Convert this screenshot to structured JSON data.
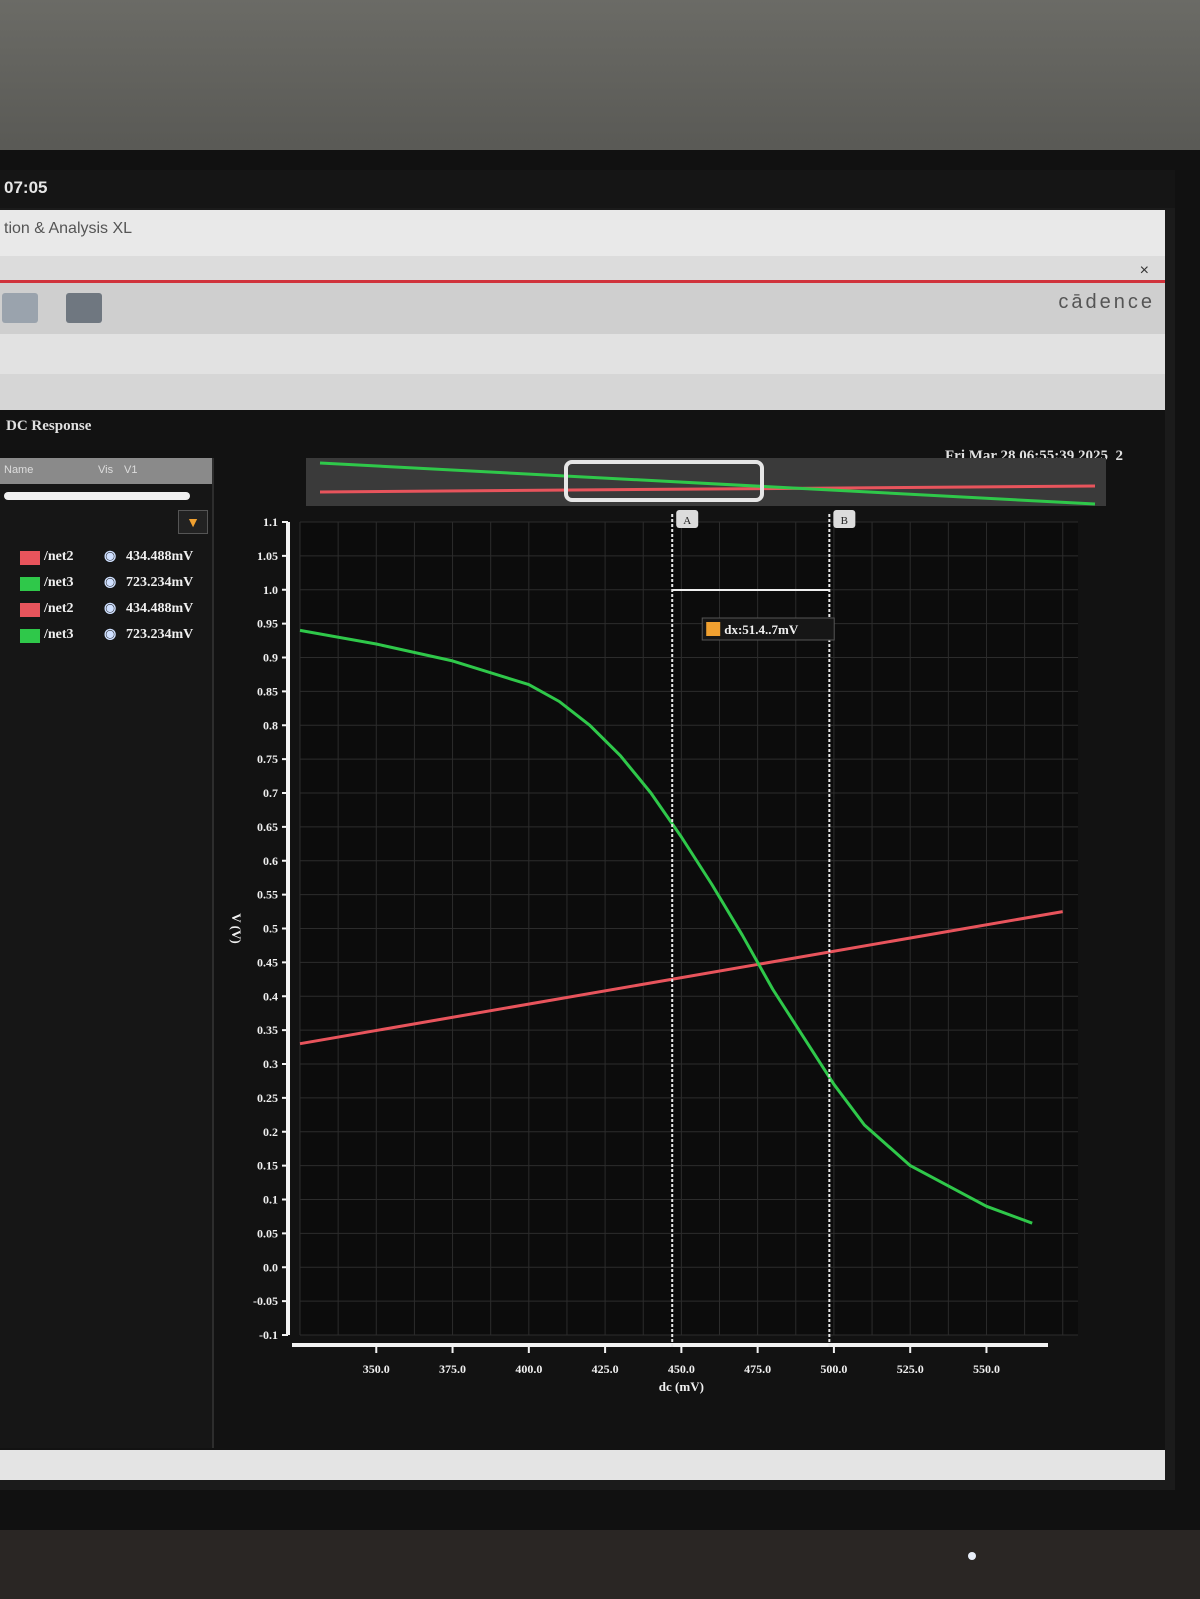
{
  "system": {
    "clock": "07:05",
    "tray_icons": [
      "network-icon",
      "volume-icon",
      "power-icon",
      "chevron-down-icon"
    ]
  },
  "app": {
    "title": "tion & Analysis XL",
    "brand": "cādence",
    "close": "×"
  },
  "window": {
    "title": "DC Response",
    "datetime": "Fri Mar 28 06:55:39 2025",
    "page_num": "2"
  },
  "panel": {
    "columns": [
      "Name",
      "Vis",
      "V1"
    ],
    "signals": [
      {
        "name": "/net2",
        "value": "434.488mV",
        "color": "#e8545c"
      },
      {
        "name": "/net3",
        "value": "723.234mV",
        "color": "#2fc84a"
      },
      {
        "name": "/net2",
        "value": "434.488mV",
        "color": "#e8545c"
      },
      {
        "name": "/net3",
        "value": "723.234mV",
        "color": "#2fc84a"
      }
    ]
  },
  "markers": {
    "a": "A",
    "b": "B",
    "delta": "dx:51.4..7mV",
    "a_x": 447,
    "b_x": 498.5
  },
  "chart_data": {
    "type": "line",
    "xlabel": "dc (mV)",
    "ylabel": "V (V)",
    "xlim": [
      325,
      580
    ],
    "ylim": [
      -0.1,
      1.1
    ],
    "xticks": [
      "350.0",
      "375.0",
      "400.0",
      "425.0",
      "450.0",
      "475.0",
      "500.0",
      "525.0",
      "550.0"
    ],
    "yticks": [
      "1.1",
      "1.05",
      "1.0",
      "0.95",
      "0.9",
      "0.85",
      "0.8",
      "0.75",
      "0.7",
      "0.65",
      "0.6",
      "0.55",
      "0.5",
      "0.45",
      "0.4",
      "0.35",
      "0.3",
      "0.25",
      "0.2",
      "0.15",
      "0.1",
      "0.05",
      "0.0",
      "-0.05",
      "-0.1"
    ],
    "grid": true,
    "series": [
      {
        "name": "/net2",
        "color": "#e8545c",
        "x": [
          325,
          575
        ],
        "y": [
          0.33,
          0.525
        ]
      },
      {
        "name": "/net3",
        "color": "#2fc84a",
        "x": [
          325,
          350,
          375,
          400,
          410,
          420,
          430,
          440,
          450,
          460,
          470,
          480,
          490,
          500,
          510,
          525,
          550,
          565
        ],
        "y": [
          0.94,
          0.92,
          0.895,
          0.86,
          0.835,
          0.8,
          0.755,
          0.7,
          0.635,
          0.565,
          0.49,
          0.41,
          0.34,
          0.27,
          0.21,
          0.15,
          0.09,
          0.065
        ]
      }
    ]
  }
}
